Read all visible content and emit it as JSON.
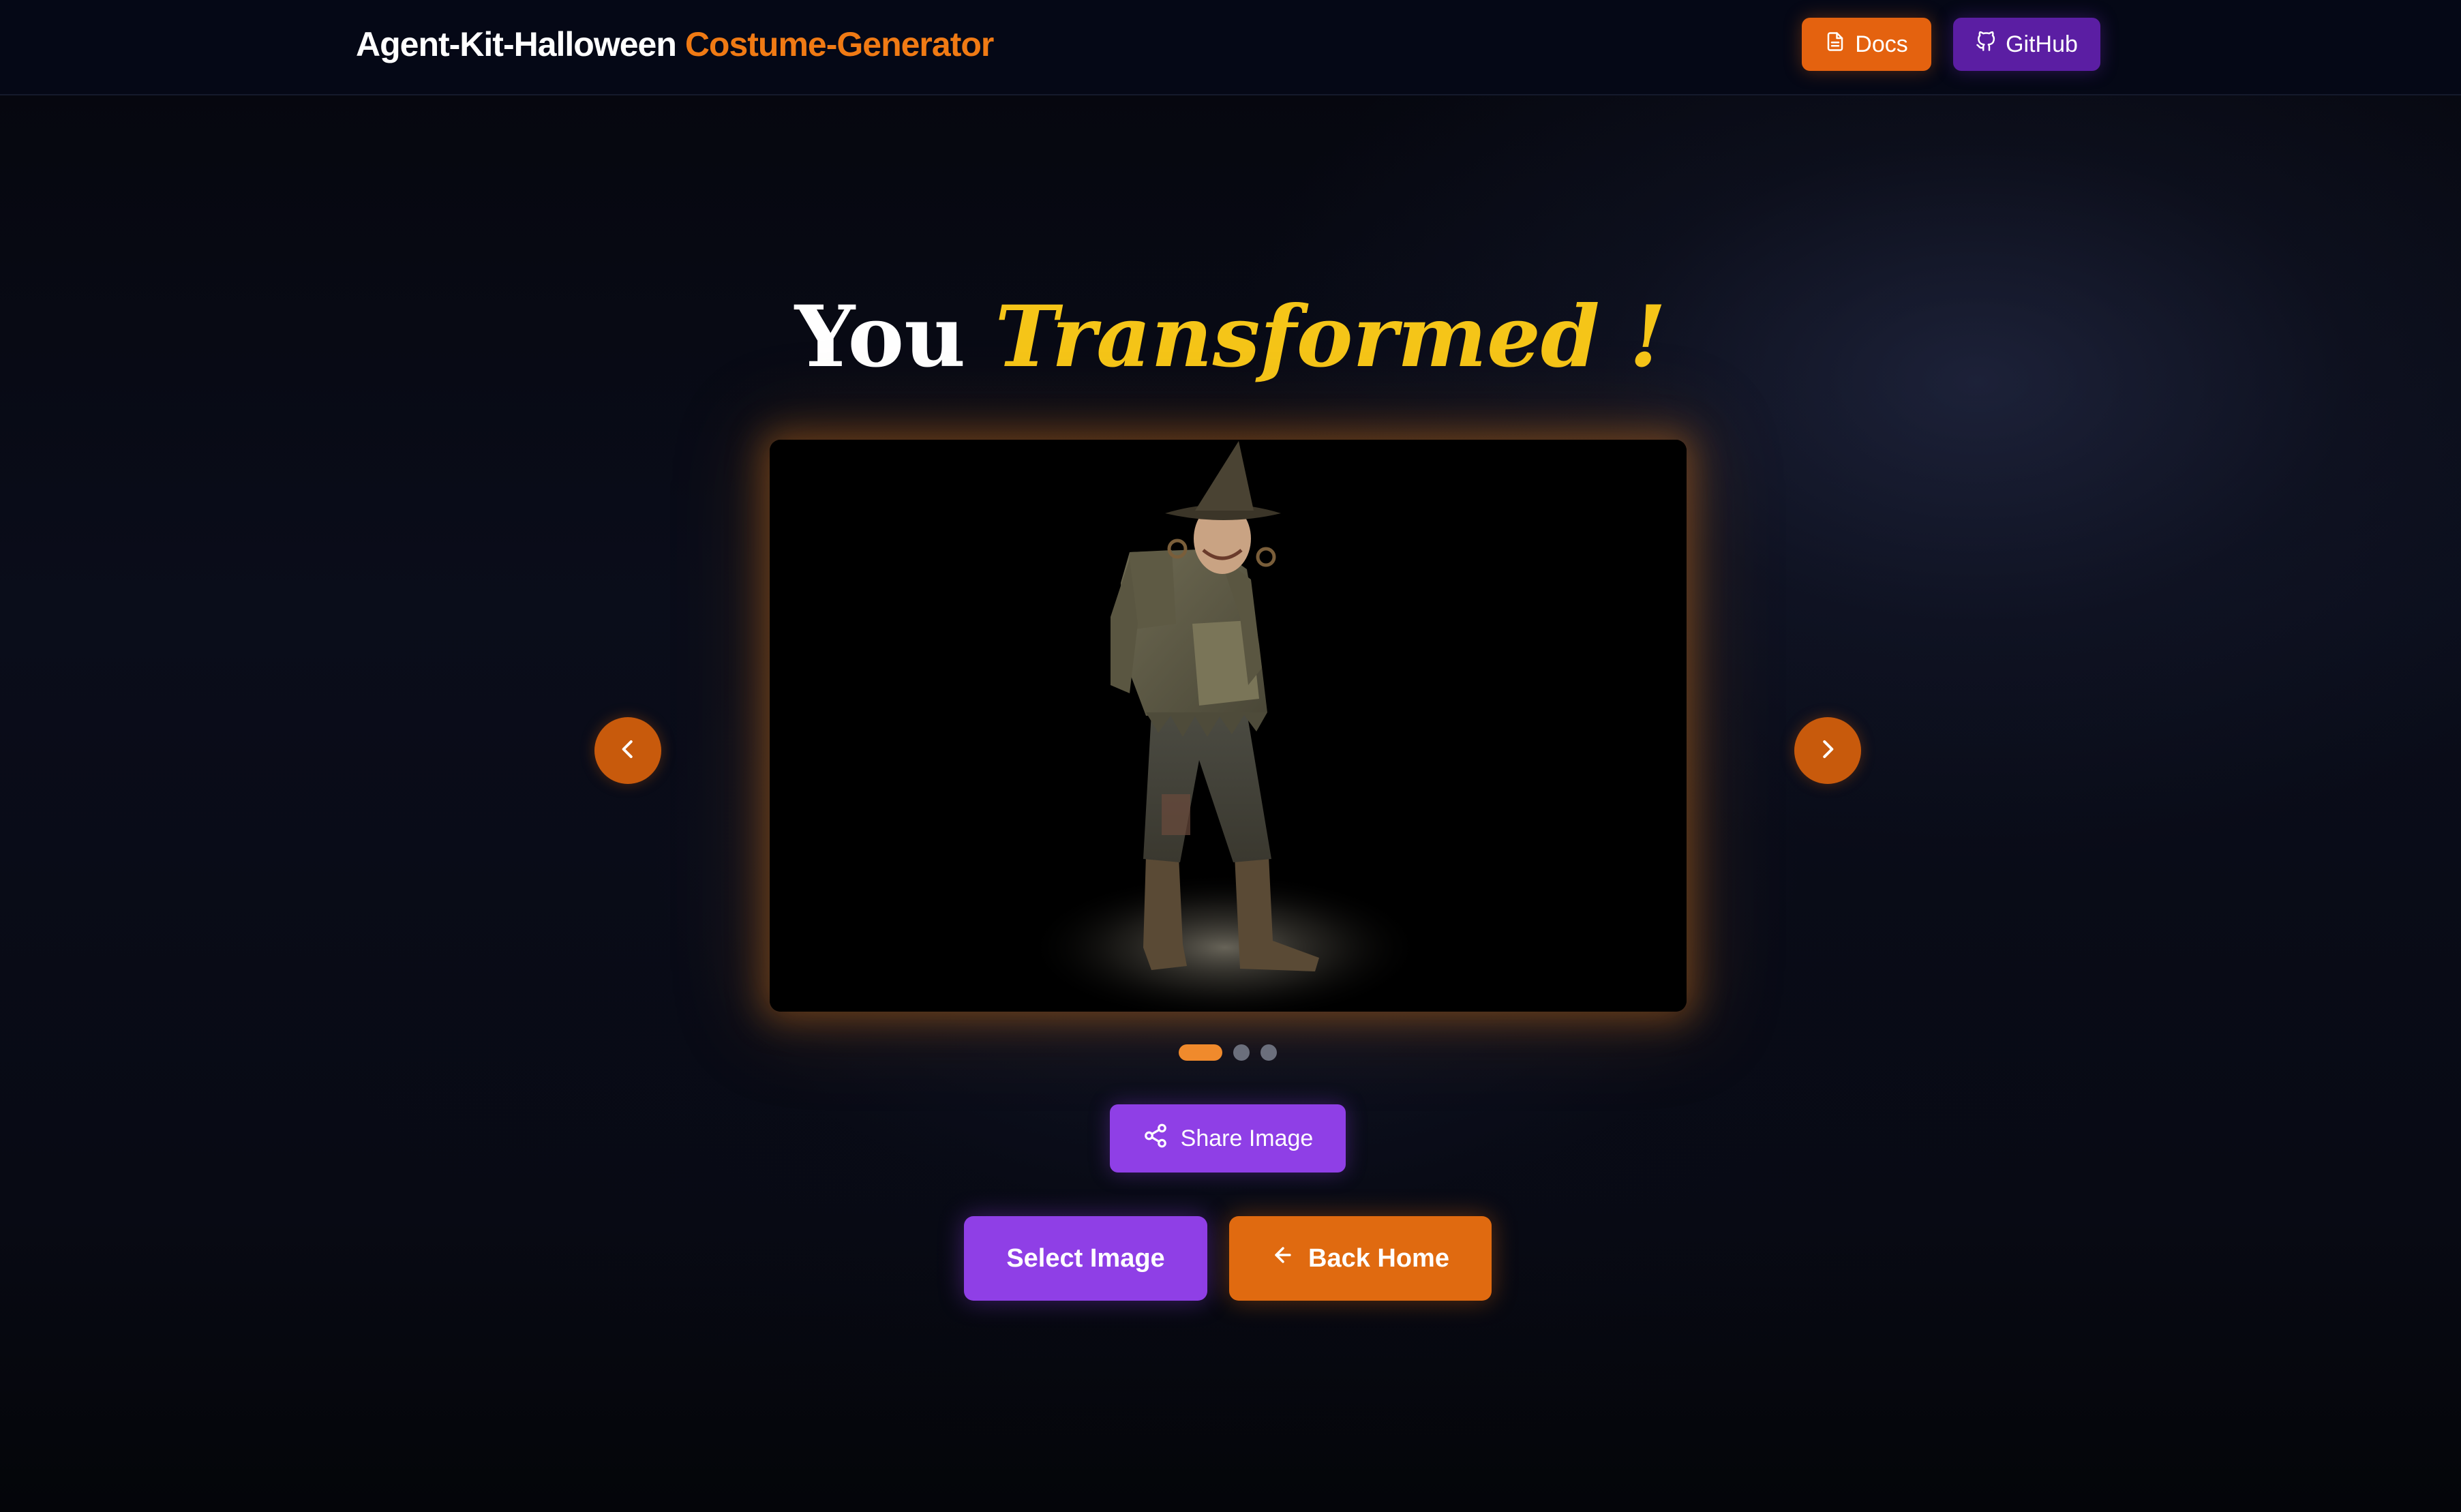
{
  "header": {
    "brand_main": "Agent-Kit-Halloween",
    "brand_accent": "Costume-Generator",
    "docs_label": "Docs",
    "github_label": "GitHub"
  },
  "hero": {
    "title_white": "You",
    "title_gold": "Transformed !"
  },
  "carousel": {
    "image_alt": "Generated Halloween costume: scarecrow with pointed witch hat and patchwork outfit",
    "slide_count": 3,
    "active_slide": 1,
    "prev_icon": "chevron-left-icon",
    "next_icon": "chevron-right-icon"
  },
  "actions": {
    "share_label": "Share Image",
    "share_icon": "share-icon",
    "select_label": "Select Image",
    "home_label": "Back Home",
    "home_icon": "arrow-left-icon"
  },
  "colors": {
    "accent_orange": "#f07a14",
    "accent_purple": "#8f3fe6",
    "title_gold": "#f5c518",
    "header_bg": "#050816"
  }
}
